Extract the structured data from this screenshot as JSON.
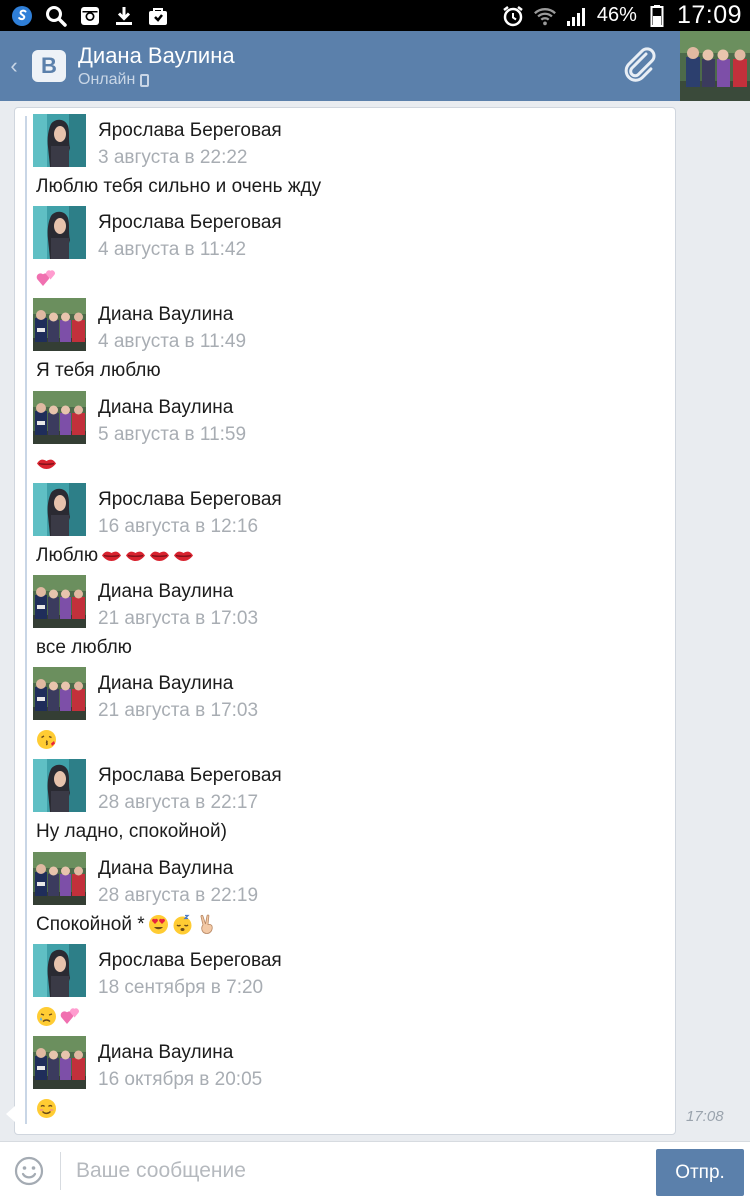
{
  "status_bar": {
    "battery_pct": "46%",
    "time": "17:09",
    "icons": [
      "s-app-icon",
      "search-icon",
      "instagram-icon",
      "download-icon",
      "bag-icon",
      "alarm-icon",
      "wifi-icon",
      "signal-icon",
      "battery-icon"
    ]
  },
  "header": {
    "title": "Диана Ваулина",
    "subtitle": "Онлайн",
    "logo": "В",
    "accent": "#5b80ab"
  },
  "message": {
    "time": "17:08",
    "forwarded": [
      {
        "sender": "Ярослава Береговая",
        "date": "3 августа в 22:22",
        "text": "Люблю тебя сильно и очень жду",
        "emojis": [],
        "avatar": "yaroslava"
      },
      {
        "sender": "Ярослава Береговая",
        "date": "4 августа в 11:42",
        "text": "",
        "emojis": [
          "two-hearts"
        ],
        "avatar": "yaroslava"
      },
      {
        "sender": "Диана Ваулина",
        "date": "4 августа в 11:49",
        "text": "Я тебя люблю",
        "emojis": [],
        "avatar": "diana"
      },
      {
        "sender": "Диана Ваулина",
        "date": "5 августа в 11:59",
        "text": "",
        "emojis": [
          "kiss-lips"
        ],
        "avatar": "diana"
      },
      {
        "sender": "Ярослава Береговая",
        "date": "16 августа в 12:16",
        "text": "Люблю",
        "emojis": [
          "kiss-lips",
          "kiss-lips",
          "kiss-lips",
          "kiss-lips"
        ],
        "avatar": "yaroslava"
      },
      {
        "sender": "Диана Ваулина",
        "date": "21 августа в 17:03",
        "text": "все люблю",
        "emojis": [],
        "avatar": "diana"
      },
      {
        "sender": "Диана Ваулина",
        "date": "21 августа в 17:03",
        "text": "",
        "emojis": [
          "kissing-face"
        ],
        "avatar": "diana"
      },
      {
        "sender": "Ярослава Береговая",
        "date": "28 августа в 22:17",
        "text": "Ну ладно, спокойной)",
        "emojis": [],
        "avatar": "yaroslava"
      },
      {
        "sender": "Диана Ваулина",
        "date": "28 августа в 22:19",
        "text": "Спокойной *",
        "emojis": [
          "heart-eyes",
          "sleeping-face",
          "victory-hand"
        ],
        "avatar": "diana"
      },
      {
        "sender": "Ярослава Береговая",
        "date": "18 сентября в 7:20",
        "text": "",
        "emojis": [
          "crying-face",
          "two-hearts"
        ],
        "avatar": "yaroslava"
      },
      {
        "sender": "Диана Ваулина",
        "date": "16 октября в 20:05",
        "text": "",
        "emojis": [
          "smiling-face"
        ],
        "avatar": "diana"
      }
    ]
  },
  "input": {
    "placeholder": "Ваше сообщение",
    "send_label": "Отпр."
  }
}
